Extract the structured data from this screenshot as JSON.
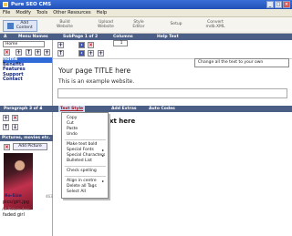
{
  "window": {
    "title": "Pure SEO CMS"
  },
  "menu": [
    "File",
    "Modify",
    "Tools",
    "Other Resources",
    "Help"
  ],
  "toolbar": [
    {
      "label": "Add\nContent"
    },
    {
      "label": "Build\nWebsite"
    },
    {
      "label": "Upload\nWebsite"
    },
    {
      "label": "Style\nEditor"
    },
    {
      "label": "Setup"
    },
    {
      "label": "Convert\nmdb.XML"
    }
  ],
  "header": {
    "a": "A",
    "menu_names": "Menu Names",
    "subpage": "SubPage 1 of 2",
    "columns": "Columns",
    "help_text": "Help Text"
  },
  "left": {
    "menu_input": "Home",
    "pages": [
      "Home",
      "Benefits",
      "Features",
      "Support",
      "Contact"
    ],
    "columns_value": "1"
  },
  "content": {
    "hint": "Change all the text to your own",
    "heading": "Your page TITLE here",
    "paragraph": "This is an example website."
  },
  "header2": {
    "paragraph": "Paragraph 3 of 4",
    "text_style": "Text Style",
    "add_extras": "Add Extras",
    "auto_codes": "Auto Codes"
  },
  "pictures": {
    "bar": "Pictures, movies etc.",
    "add_button": "Add Picture",
    "resize": "Re-Size",
    "dims": "463",
    "file": "pics/girl.jpg",
    "alt_hint": "Alt Picture desc.",
    "alt": "faded girl"
  },
  "editor": {
    "heading_tail": "xt here"
  },
  "context_menu": {
    "items": [
      "Copy",
      "Cut",
      "Paste",
      "Undo",
      "Make text bold",
      "Special Fonts",
      "Special Characters",
      "Bulleted List",
      "Check spelling",
      "Align in centre",
      "Delete all Tags",
      "Select All"
    ]
  }
}
